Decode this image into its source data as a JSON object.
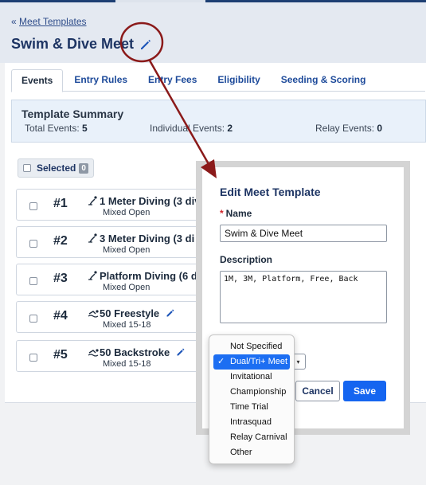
{
  "breadcrumb": {
    "prefix": "«",
    "link": "Meet Templates"
  },
  "page": {
    "title": "Swim & Dive Meet"
  },
  "tabs": [
    {
      "label": "Events",
      "active": true
    },
    {
      "label": "Entry Rules"
    },
    {
      "label": "Entry Fees"
    },
    {
      "label": "Eligibility"
    },
    {
      "label": "Seeding & Scoring"
    }
  ],
  "summary": {
    "title": "Template Summary",
    "total_label": "Total Events:",
    "total_value": "5",
    "individual_label": "Individual Events:",
    "individual_value": "2",
    "relay_label": "Relay Events:",
    "relay_value": "0"
  },
  "selection": {
    "label": "Selected",
    "count": "0"
  },
  "events": [
    {
      "num": "#1",
      "name": "1 Meter Diving (3 div",
      "sub": "Mixed Open",
      "icon": "diving-icon"
    },
    {
      "num": "#2",
      "name": "3 Meter Diving (3 di",
      "sub": "Mixed Open",
      "icon": "diving-icon"
    },
    {
      "num": "#3",
      "name": "Platform Diving (6 d",
      "sub": "Mixed Open",
      "icon": "diving-icon"
    },
    {
      "num": "#4",
      "name": "50 Freestyle",
      "sub": "Mixed 15-18",
      "icon": "swimming-icon"
    },
    {
      "num": "#5",
      "name": "50 Backstroke",
      "sub": "Mixed 15-18",
      "icon": "swimming-icon"
    }
  ],
  "modal": {
    "title": "Edit Meet Template",
    "required_mark": "*",
    "name_label": "Name",
    "name_value": "Swim & Dive Meet",
    "description_label": "Description",
    "description_value": "1M, 3M, Platform, Free, Back",
    "cancel_label": "Cancel",
    "save_label": "Save"
  },
  "meet_type_dropdown": {
    "options": [
      "Not Specified",
      "Dual/Tri+ Meet",
      "Invitational",
      "Championship",
      "Time Trial",
      "Intrasquad",
      "Relay Carnival",
      "Other"
    ],
    "selected": "Dual/Tri+ Meet",
    "selected_mark": "✓"
  },
  "colors": {
    "primary": "#1565f0",
    "title_navy": "#1d3463",
    "annotation_red": "#8b1a1a",
    "dropdown_highlight": "#1c6ef2"
  }
}
